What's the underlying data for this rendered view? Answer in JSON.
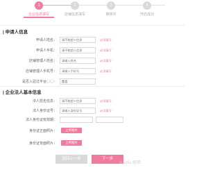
{
  "stepper": {
    "steps": [
      {
        "number": "1",
        "label": "企业信息填写"
      },
      {
        "number": "2",
        "label": "店铺信息填写"
      },
      {
        "number": "3",
        "label": "审核中"
      },
      {
        "number": "4",
        "label": "开店成功"
      }
    ],
    "active_step": 1
  },
  "applicant_section": {
    "title": "| 申请人信息",
    "fields": [
      {
        "label": "申请人姓名：",
        "placeholder": "请不能超人信息",
        "required": "必须填写"
      },
      {
        "label": "申请人手机：",
        "placeholder": "请不能超人信息",
        "required": "必须填写"
      },
      {
        "label": "店铺管理人姓名：",
        "placeholder": "请输入姓名",
        "required": "必须填写"
      },
      {
        "label": "店铺管理人手机号：",
        "placeholder": "请输入手机号",
        "required": "必须填写"
      },
      {
        "label": "是否入驻过平台◯◯：",
        "value": "是否"
      }
    ]
  },
  "company_section": {
    "title": "| 企业法人基本信息",
    "fields": [
      {
        "label": "法人姓名信息：",
        "placeholder": "请不能超人信息",
        "required": "必须填写"
      },
      {
        "label": "法人身份证号：",
        "placeholder": "请输入身份证号",
        "required": "必须填写"
      },
      {
        "label": "法人身份证有效期：",
        "placeholder": "",
        "placeholder2": ""
      }
    ],
    "uploads": [
      {
        "label": "身份证正面照片：",
        "button": "上传图片"
      },
      {
        "label": "身份证背面照片：",
        "button": "上传图片"
      }
    ]
  },
  "footer": {
    "prev_label": "返回上一步",
    "next_label": "下一步"
  },
  "watermark": "Baidu 经验"
}
